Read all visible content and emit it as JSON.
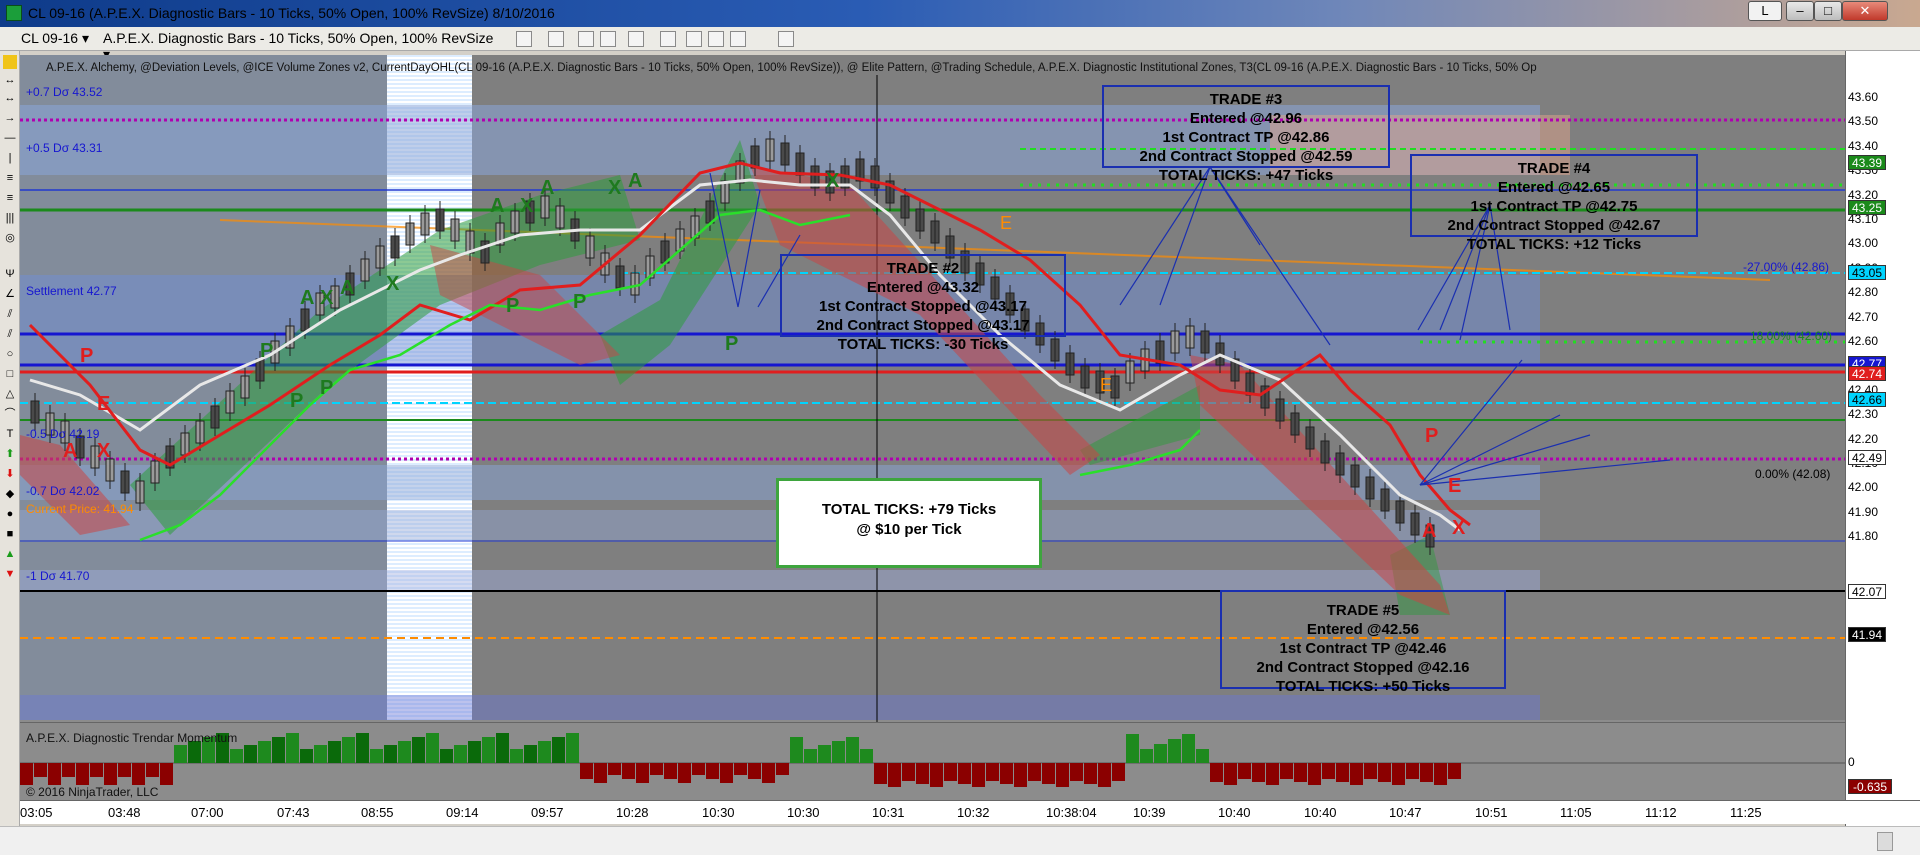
{
  "window": {
    "title": "CL 09-16 (A.P.E.X. Diagnostic Bars - 10 Ticks, 50% Open, 100% RevSize)  8/10/2016",
    "btn_l": "L"
  },
  "toolbar": {
    "instrument": "CL 09-16",
    "chart_type": "A.P.E.X. Diagnostic Bars - 10 Ticks, 50% Open, 100% RevSize"
  },
  "indicators_line": "A.P.E.X. Alchemy, @Deviation Levels, @ICE Volume Zones v2, CurrentDayOHL(CL 09-16 (A.P.E.X. Diagnostic Bars - 10 Ticks, 50% Open, 100% RevSize)), @ Elite Pattern, @Trading Schedule, A.P.E.X. Diagnostic Institutional Zones, T3(CL 09-16 (A.P.E.X. Diagnostic Bars - 10 Ticks, 50% Op",
  "level_labels": {
    "dev_p07": "+0.7 Dσ 43.52",
    "dev_p05": "+0.5 Dσ 43.31",
    "settlement": "Settlement 42.77",
    "dev_m05": "-0.5 Dσ 42.19",
    "dev_m07": "-0.7 Dσ 42.02",
    "current_price": "Current Price: 41.94",
    "dev_m1": "-1 Dσ 41.70",
    "fib_27": "-27.00% (42.86)",
    "fib_18": "18.00% (42.60)",
    "fib_0": "0.00% (42.08)"
  },
  "trades": {
    "t2": {
      "title": "TRADE #2",
      "l1": "Entered @43.32",
      "l2": "1st Contract Stopped @43.17",
      "l3": "2nd Contract Stopped @43.17",
      "l4": "TOTAL TICKS: -30 Ticks"
    },
    "t3": {
      "title": "TRADE #3",
      "l1": "Entered @42.96",
      "l2": "1st Contract TP @42.86",
      "l3": "2nd Contract Stopped @42.59",
      "l4": "TOTAL TICKS: +47 Ticks"
    },
    "t4": {
      "title": "TRADE #4",
      "l1": "Entered @42.65",
      "l2": "1st Contract TP @42.75",
      "l3": "2nd Contract Stopped @42.67",
      "l4": "TOTAL TICKS: +12 Ticks"
    },
    "t5": {
      "title": "TRADE #5",
      "l1": "Entered @42.56",
      "l2": "1st Contract TP @42.46",
      "l3": "2nd Contract Stopped @42.16",
      "l4": "TOTAL TICKS: +50 Ticks"
    }
  },
  "total": {
    "l1": "TOTAL TICKS: +79 Ticks",
    "l2": "@ $10 per Tick"
  },
  "price_axis": [
    "43.60",
    "43.50",
    "43.40",
    "43.30",
    "43.20",
    "43.10",
    "43.00",
    "42.90",
    "42.80",
    "42.70",
    "42.60",
    "42.50",
    "42.40",
    "42.30",
    "42.20",
    "42.10",
    "42.00",
    "41.90",
    "41.80"
  ],
  "price_tags": {
    "t4339": "43.39",
    "t4325": "43.25",
    "t4305": "43.05",
    "t4277": "42.77",
    "t4274": "42.74",
    "t4266": "42.66",
    "t4249": "42.49",
    "t4207": "42.07",
    "t4194": "41.94"
  },
  "momentum": {
    "title": "A.P.E.X. Diagnostic Trendar Momentum",
    "copyright": "© 2016 NinjaTrader, LLC",
    "zero": "0",
    "value": "-0.635"
  },
  "time_axis": [
    "03:05",
    "03:48",
    "07:00",
    "07:43",
    "08:55",
    "09:14",
    "09:57",
    "10:28",
    "10:30",
    "10:30",
    "10:31",
    "10:32",
    "10:38:04",
    "10:39",
    "10:40",
    "10:40",
    "10:47",
    "10:51",
    "11:05",
    "11:12",
    "11:25"
  ],
  "letters": {
    "A": "A",
    "X": "X",
    "E": "E",
    "P": "P"
  },
  "colors": {
    "bull": "#1e7a1e",
    "bear": "#c81e1e",
    "blue_level": "#1616d0",
    "magenta": "#b000b0",
    "cyan": "#00d4ff",
    "orange": "#ff8c00"
  }
}
